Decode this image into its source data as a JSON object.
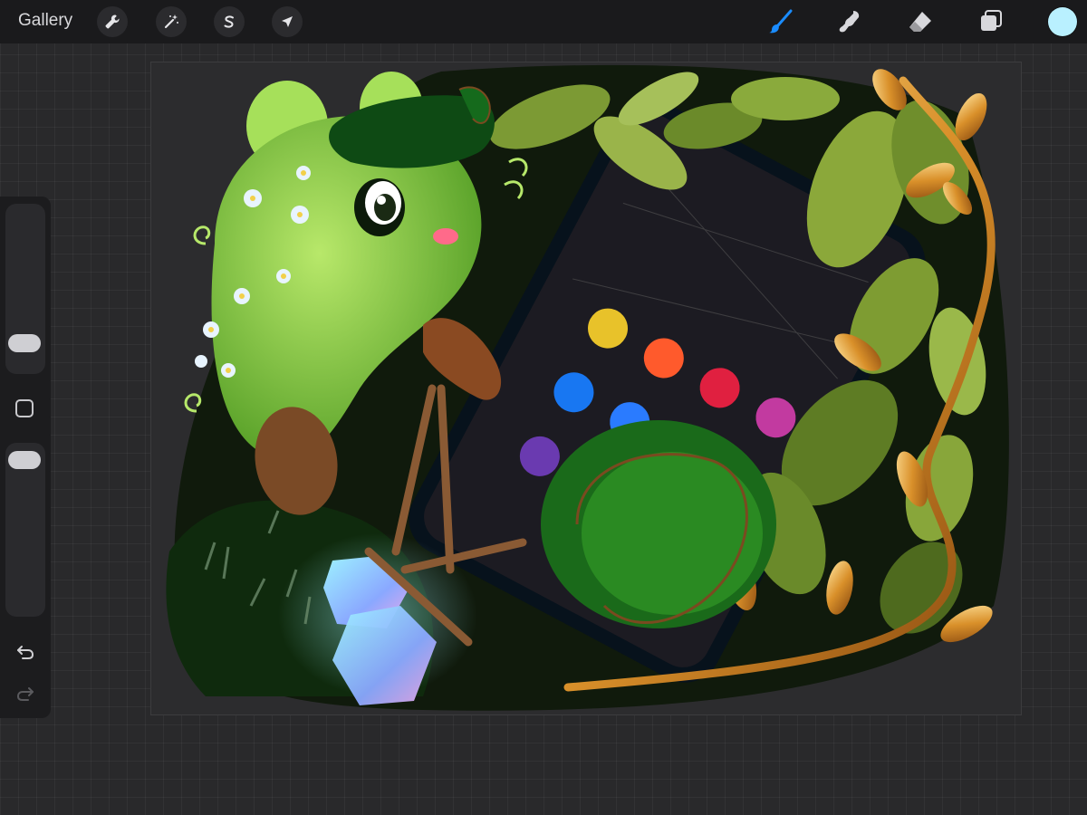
{
  "topbar": {
    "gallery_label": "Gallery",
    "left_tools": [
      "wrench-icon",
      "magic-wand-icon",
      "selection-s-icon",
      "transform-arrow-icon"
    ],
    "right_tools": [
      "brush-icon",
      "smudge-icon",
      "eraser-icon",
      "layers-icon"
    ],
    "current_color": "#b9f0ff"
  },
  "sidebar": {
    "controls": [
      "brush-size-slider",
      "modify-button",
      "opacity-slider",
      "undo-icon",
      "redo-icon"
    ]
  },
  "colors": {
    "toolbar_bg": "#1a1a1c",
    "accent_brush": "#1a8cff",
    "canvas_bg": "#2c2c2e"
  }
}
